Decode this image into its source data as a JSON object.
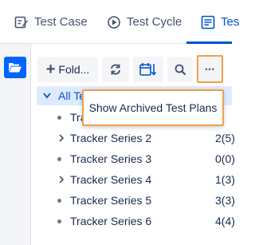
{
  "tabs": [
    {
      "label": "Test Case",
      "icon": "edit-icon"
    },
    {
      "label": "Test Cycle",
      "icon": "cycle-icon"
    },
    {
      "label": "Tes",
      "icon": "plan-icon",
      "active": true
    }
  ],
  "leftrail": {
    "icon": "folder-open-icon"
  },
  "toolbar": {
    "add_folder_label": "Fold...",
    "more_label": "•••"
  },
  "tree": {
    "root_label": "All Te",
    "items": [
      {
        "label": "Tra",
        "count": "",
        "expandable": false
      },
      {
        "label": "Tracker Series 2",
        "count": "2(5)",
        "expandable": true
      },
      {
        "label": "Tracker Series 3",
        "count": "0(0)",
        "expandable": false
      },
      {
        "label": "Tracker Series 4",
        "count": "1(3)",
        "expandable": true
      },
      {
        "label": "Tracker Series 5",
        "count": "3(3)",
        "expandable": false
      },
      {
        "label": "Tracker Series 6",
        "count": "4(4)",
        "expandable": false
      }
    ]
  },
  "popup": {
    "label": "Show Archived Test Plans"
  },
  "colors": {
    "accent": "#0052cc",
    "highlight": "#f0a04b",
    "selected_bg": "#deebff"
  }
}
